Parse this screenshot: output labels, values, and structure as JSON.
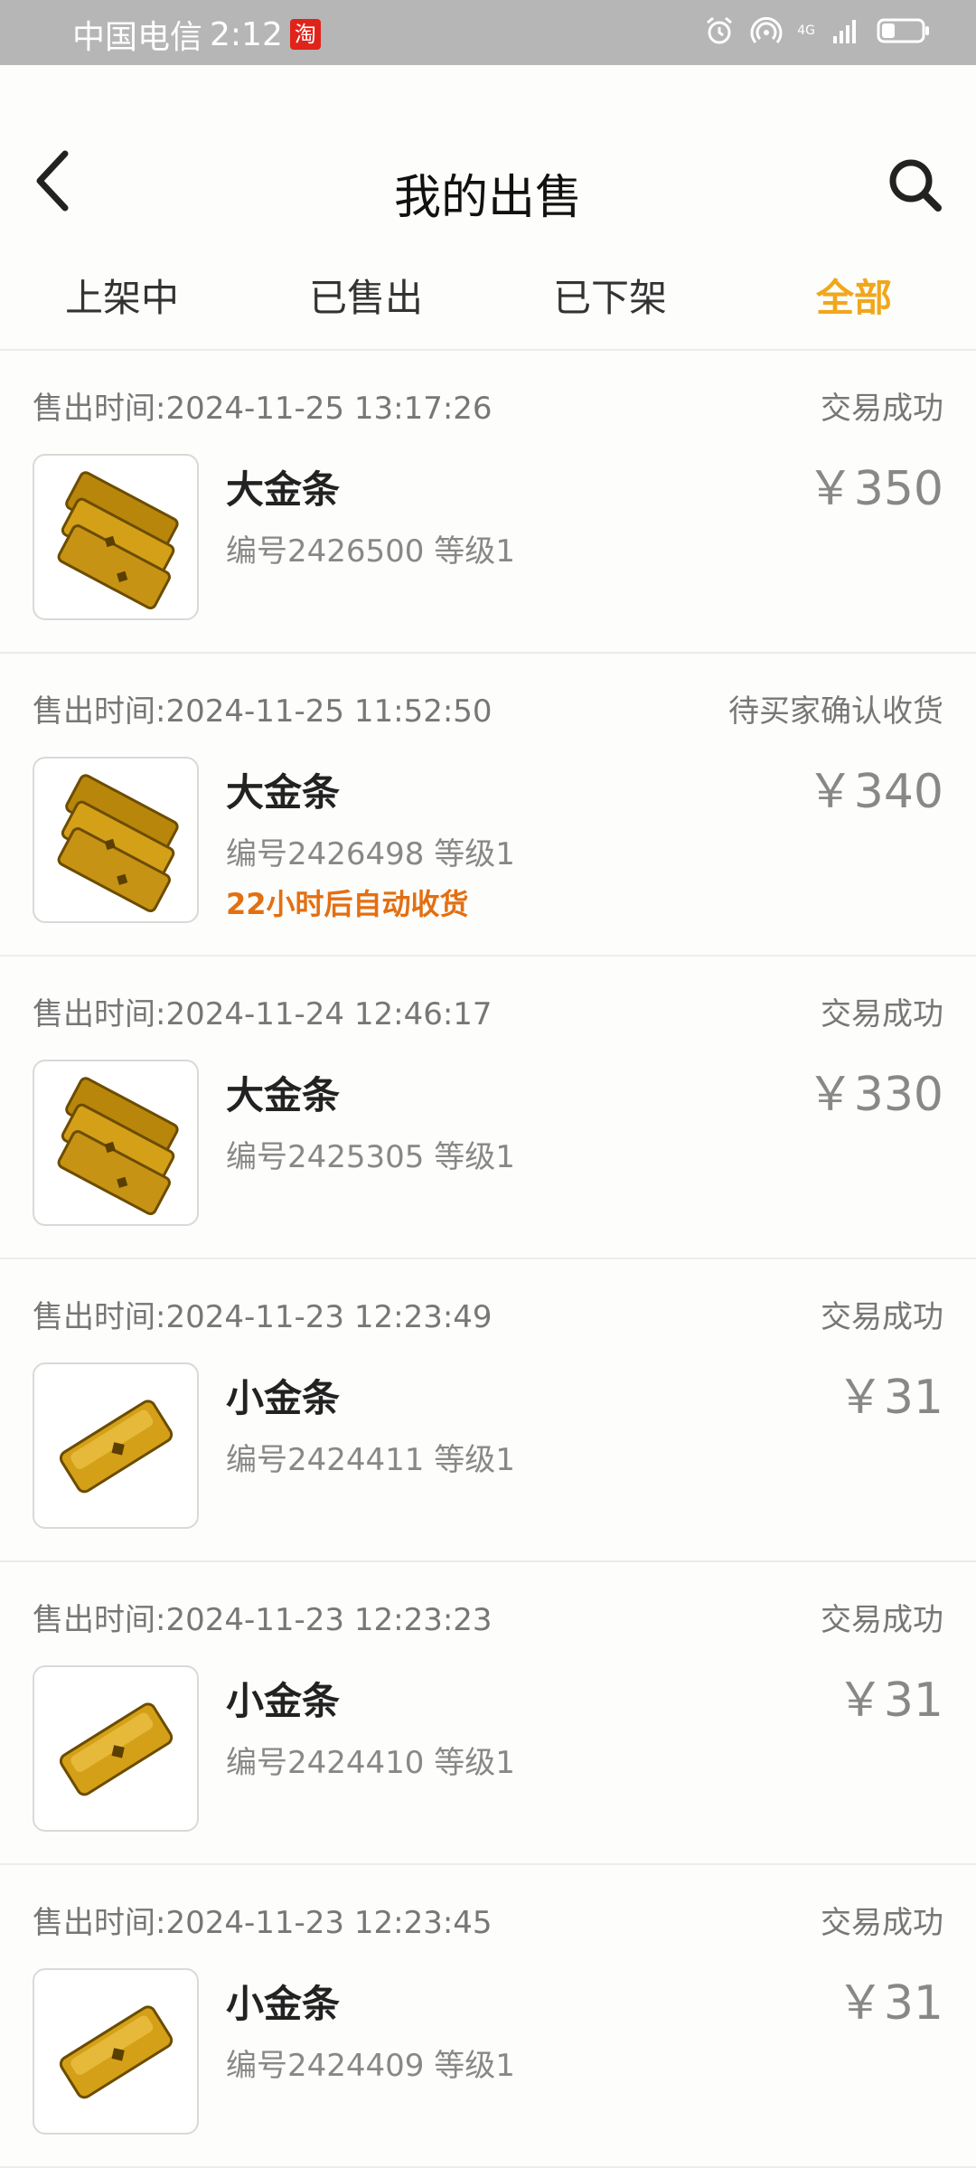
{
  "status_bar": {
    "carrier": "中国电信",
    "time": "2:12",
    "app_badge": "淘",
    "network": "4G",
    "icons": [
      "alarm-icon",
      "hotspot-icon",
      "signal-icon",
      "battery-icon"
    ]
  },
  "header": {
    "title": "我的出售",
    "back_icon": "chevron-left-icon",
    "search_icon": "search-icon"
  },
  "tabs": [
    {
      "label": "上架中",
      "active": false
    },
    {
      "label": "已售出",
      "active": false
    },
    {
      "label": "已下架",
      "active": false
    },
    {
      "label": "全部",
      "active": true
    }
  ],
  "orders": [
    {
      "time": "售出时间:2024-11-25 13:17:26",
      "status": "交易成功",
      "name": "大金条",
      "meta": "编号2426500 等级1",
      "price": "￥350",
      "note": "",
      "item_type": "big-gold-bar"
    },
    {
      "time": "售出时间:2024-11-25 11:52:50",
      "status": "待买家确认收货",
      "name": "大金条",
      "meta": "编号2426498 等级1",
      "price": "￥340",
      "note": "22小时后自动收货",
      "item_type": "big-gold-bar"
    },
    {
      "time": "售出时间:2024-11-24 12:46:17",
      "status": "交易成功",
      "name": "大金条",
      "meta": "编号2425305 等级1",
      "price": "￥330",
      "note": "",
      "item_type": "big-gold-bar"
    },
    {
      "time": "售出时间:2024-11-23 12:23:49",
      "status": "交易成功",
      "name": "小金条",
      "meta": "编号2424411 等级1",
      "price": "￥31",
      "note": "",
      "item_type": "small-gold-bar"
    },
    {
      "time": "售出时间:2024-11-23 12:23:23",
      "status": "交易成功",
      "name": "小金条",
      "meta": "编号2424410 等级1",
      "price": "￥31",
      "note": "",
      "item_type": "small-gold-bar"
    },
    {
      "time": "售出时间:2024-11-23 12:23:45",
      "status": "交易成功",
      "name": "小金条",
      "meta": "编号2424409 等级1",
      "price": "￥31",
      "note": "",
      "item_type": "small-gold-bar"
    }
  ],
  "colors": {
    "accent": "#f0a71c",
    "note": "#e36f12",
    "gold": "#d4a017",
    "status_bar": "#b6b6b6"
  }
}
